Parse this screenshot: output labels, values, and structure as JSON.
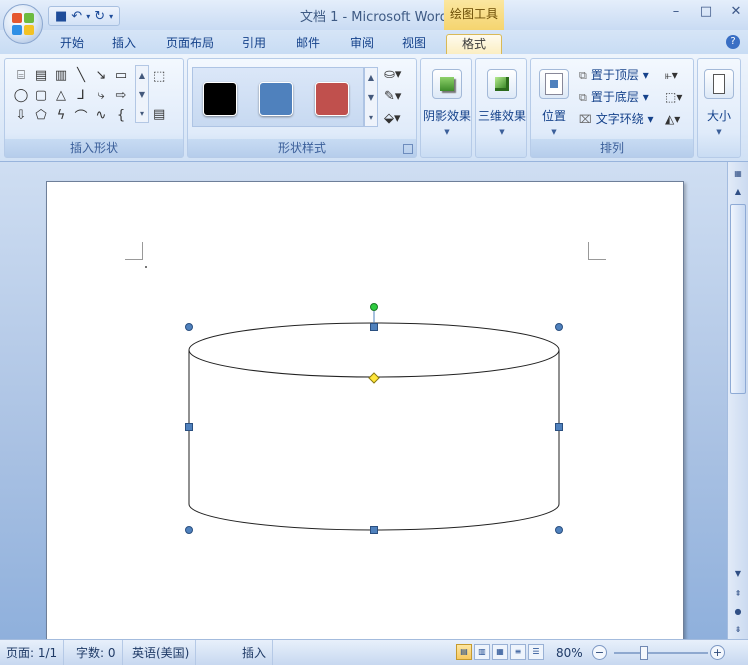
{
  "title_bar": {
    "title": "文档 1 - Microsoft Word",
    "context_group": "绘图工具"
  },
  "tabs": [
    {
      "label": "开始"
    },
    {
      "label": "插入"
    },
    {
      "label": "页面布局"
    },
    {
      "label": "引用"
    },
    {
      "label": "邮件"
    },
    {
      "label": "审阅"
    },
    {
      "label": "视图"
    },
    {
      "label": "格式",
      "active": true
    }
  ],
  "ribbon": {
    "insert_shapes": {
      "label": "插入形状"
    },
    "shape_styles": {
      "label": "形状样式",
      "swatches": [
        "#000000",
        "#4f81bd",
        "#c0504d"
      ]
    },
    "shadow_effects": {
      "label": "阴影效果"
    },
    "effects_3d": {
      "label": "三维效果"
    },
    "arrange": {
      "label": "排列",
      "position": "位置",
      "bring_front": "置于顶层",
      "send_back": "置于底层",
      "text_wrap": "文字环绕"
    },
    "size": {
      "label": "大小"
    }
  },
  "statusbar": {
    "page": "页面: 1/1",
    "words": "字数: 0",
    "language": "英语(美国)",
    "mode": "插入",
    "zoom": "80%"
  },
  "colors": {
    "accent": "#15428b",
    "handle": "#4f81bd",
    "rotate_handle": "#2ecc40",
    "adjust_handle": "#ffe63b"
  }
}
